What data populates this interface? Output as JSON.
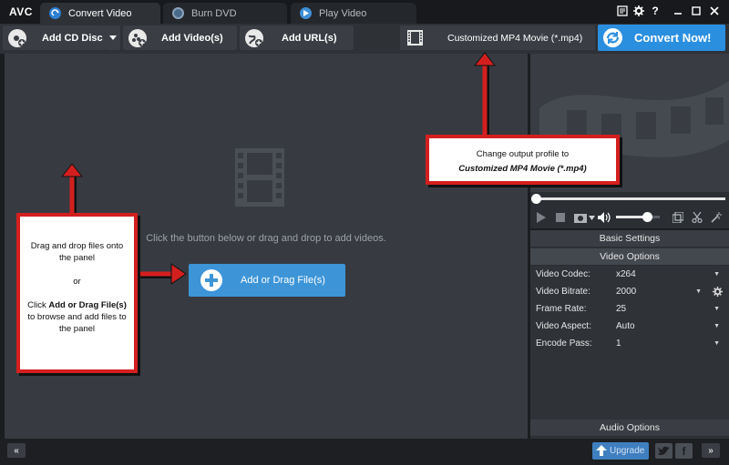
{
  "app": {
    "logo": "AVC"
  },
  "tabs": [
    {
      "label": "Convert Video",
      "icon": "convert-icon",
      "active": true
    },
    {
      "label": "Burn DVD",
      "icon": "dvd-icon",
      "active": false
    },
    {
      "label": "Play Video",
      "icon": "play-icon",
      "active": false
    }
  ],
  "toolbar": {
    "add_cd": "Add CD Disc",
    "add_videos": "Add Video(s)",
    "add_urls": "Add URL(s)",
    "profile": "Customized MP4 Movie (*.mp4)",
    "convert_now": "Convert Now!"
  },
  "drop_panel": {
    "hint": "Click the button below or drag and drop to add videos.",
    "add_drag": "Add or Drag File(s)"
  },
  "settings": {
    "basic": "Basic Settings",
    "video_options": "Video Options",
    "audio_options": "Audio Options",
    "rows": [
      {
        "label": "Video Codec:",
        "value": "x264"
      },
      {
        "label": "Video Bitrate:",
        "value": "2000"
      },
      {
        "label": "Frame Rate:",
        "value": "25"
      },
      {
        "label": "Video Aspect:",
        "value": "Auto"
      },
      {
        "label": "Encode Pass:",
        "value": "1"
      }
    ]
  },
  "player": {
    "volume_level": 0.7,
    "seek_position": 0.0
  },
  "bottom": {
    "upgrade": "Upgrade",
    "collapse": "«",
    "expand": "»"
  },
  "annotations": {
    "profile_note_line1": "Change output profile to",
    "profile_note_line2": "Customized MP4 Movie (*.mp4)",
    "drag_note_1": "Drag and drop files onto the panel",
    "drag_note_or": "or",
    "drag_note_click": "Click ",
    "drag_note_bold": "Add or Drag File(s)",
    "drag_note_rest": " to browse and add files to the panel"
  },
  "colors": {
    "accent": "#2b8fe0",
    "annotation_red": "#d41f1f",
    "panel": "#373b41"
  }
}
